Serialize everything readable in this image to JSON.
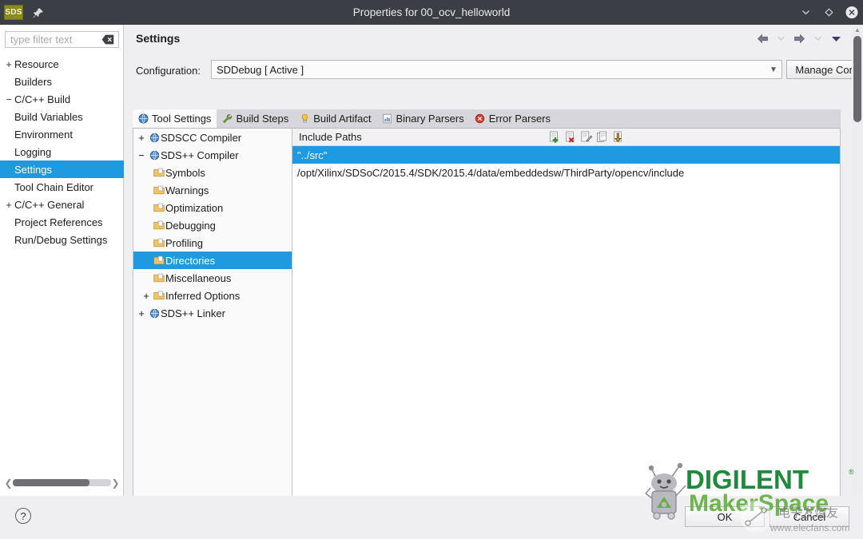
{
  "window": {
    "app_badge": "SDS",
    "title": "Properties for 00_ocv_helloworld",
    "minimize_icon": "chevron-down-icon",
    "maximize_icon": "diamond-icon",
    "close_icon": "close-icon",
    "pin_icon": "pin-icon"
  },
  "sidebar": {
    "filter": {
      "placeholder": "type filter text",
      "value": "",
      "clear_icon": "clear-backspace-icon"
    },
    "items": [
      {
        "label": "Resource",
        "expander": "+",
        "depth": 0,
        "selected": false
      },
      {
        "label": "Builders",
        "expander": "",
        "depth": 1,
        "selected": false
      },
      {
        "label": "C/C++ Build",
        "expander": "−",
        "depth": 0,
        "selected": false
      },
      {
        "label": "Build Variables",
        "expander": "",
        "depth": 1,
        "selected": false
      },
      {
        "label": "Environment",
        "expander": "",
        "depth": 1,
        "selected": false
      },
      {
        "label": "Logging",
        "expander": "",
        "depth": 1,
        "selected": false
      },
      {
        "label": "Settings",
        "expander": "",
        "depth": 1,
        "selected": true
      },
      {
        "label": "Tool Chain Editor",
        "expander": "",
        "depth": 1,
        "selected": false
      },
      {
        "label": "C/C++ General",
        "expander": "+",
        "depth": 0,
        "selected": false
      },
      {
        "label": "Project References",
        "expander": "",
        "depth": 1,
        "selected": false
      },
      {
        "label": "Run/Debug Settings",
        "expander": "",
        "depth": 1,
        "selected": false
      }
    ],
    "scroll_left_icon": "chevron-left-icon",
    "scroll_right_icon": "chevron-right-icon"
  },
  "header": {
    "title": "Settings",
    "back_icon": "arrow-left-icon",
    "back_menu_icon": "chevron-down-icon",
    "forward_icon": "arrow-right-icon",
    "forward_menu_icon": "chevron-down-icon",
    "view_menu_icon": "triangle-down-icon"
  },
  "configuration": {
    "label": "Configuration:",
    "value": "SDDebug  [ Active ]",
    "dropdown_icon": "chevron-down-icon",
    "manage_button": "Manage Configurations..."
  },
  "tabs": [
    {
      "label": "Tool Settings",
      "icon": "globe-wrench-icon",
      "active": true
    },
    {
      "label": "Build Steps",
      "icon": "wrench-icon",
      "active": false
    },
    {
      "label": "Build Artifact",
      "icon": "lightbulb-icon",
      "active": false
    },
    {
      "label": "Binary Parsers",
      "icon": "document-chart-icon",
      "active": false
    },
    {
      "label": "Error Parsers",
      "icon": "error-circle-icon",
      "active": false
    }
  ],
  "tool_tree": [
    {
      "label": "SDSCC Compiler",
      "expander": "+",
      "icon": "globe-tool-icon",
      "depth": 0,
      "selected": false
    },
    {
      "label": "SDS++ Compiler",
      "expander": "−",
      "icon": "globe-tool-icon",
      "depth": 0,
      "selected": false
    },
    {
      "label": "Symbols",
      "expander": "",
      "icon": "folder-page-icon",
      "depth": 1,
      "selected": false
    },
    {
      "label": "Warnings",
      "expander": "",
      "icon": "folder-page-icon",
      "depth": 1,
      "selected": false
    },
    {
      "label": "Optimization",
      "expander": "",
      "icon": "folder-page-icon",
      "depth": 1,
      "selected": false
    },
    {
      "label": "Debugging",
      "expander": "",
      "icon": "folder-page-icon",
      "depth": 1,
      "selected": false
    },
    {
      "label": "Profiling",
      "expander": "",
      "icon": "folder-page-icon",
      "depth": 1,
      "selected": false
    },
    {
      "label": "Directories",
      "expander": "",
      "icon": "folder-page-icon",
      "depth": 1,
      "selected": true
    },
    {
      "label": "Miscellaneous",
      "expander": "",
      "icon": "folder-page-icon",
      "depth": 1,
      "selected": false
    },
    {
      "label": "Inferred Options",
      "expander": "+",
      "icon": "folder-page-icon",
      "depth": 2,
      "selected": false
    },
    {
      "label": "SDS++ Linker",
      "expander": "+",
      "icon": "globe-tool-icon",
      "depth": 0,
      "selected": false
    }
  ],
  "include_paths": {
    "title": "Include Paths",
    "toolbar": [
      {
        "name": "add-icon",
        "tip": "Add"
      },
      {
        "name": "delete-icon",
        "tip": "Delete"
      },
      {
        "name": "edit-icon",
        "tip": "Edit"
      },
      {
        "name": "copy-icon",
        "tip": "Copy"
      },
      {
        "name": "move-down-icon",
        "tip": "Move Down"
      }
    ],
    "rows": [
      {
        "value": "\"../src\"",
        "selected": true
      },
      {
        "value": "/opt/Xilinx/SDSoC/2015.4/SDK/2015.4/data/embeddedsw/ThirdParty/opencv/include",
        "selected": false
      }
    ]
  },
  "footer": {
    "help_icon": "?",
    "ok": "OK",
    "cancel": "Cancel"
  },
  "watermarks": {
    "digilent_primary": "DIGILENT",
    "digilent_secondary": "MakerSpace",
    "digilent_registered": "®",
    "elecfans_cn": "电子发烧友",
    "elecfans_url": "www.elecfans.com"
  },
  "colors": {
    "titlebar": "#3b3f45",
    "selection": "#1f9ae0",
    "panel": "#efeff1",
    "digilent_green": "#1f8a3c",
    "digilent_light_green": "#66b043"
  }
}
